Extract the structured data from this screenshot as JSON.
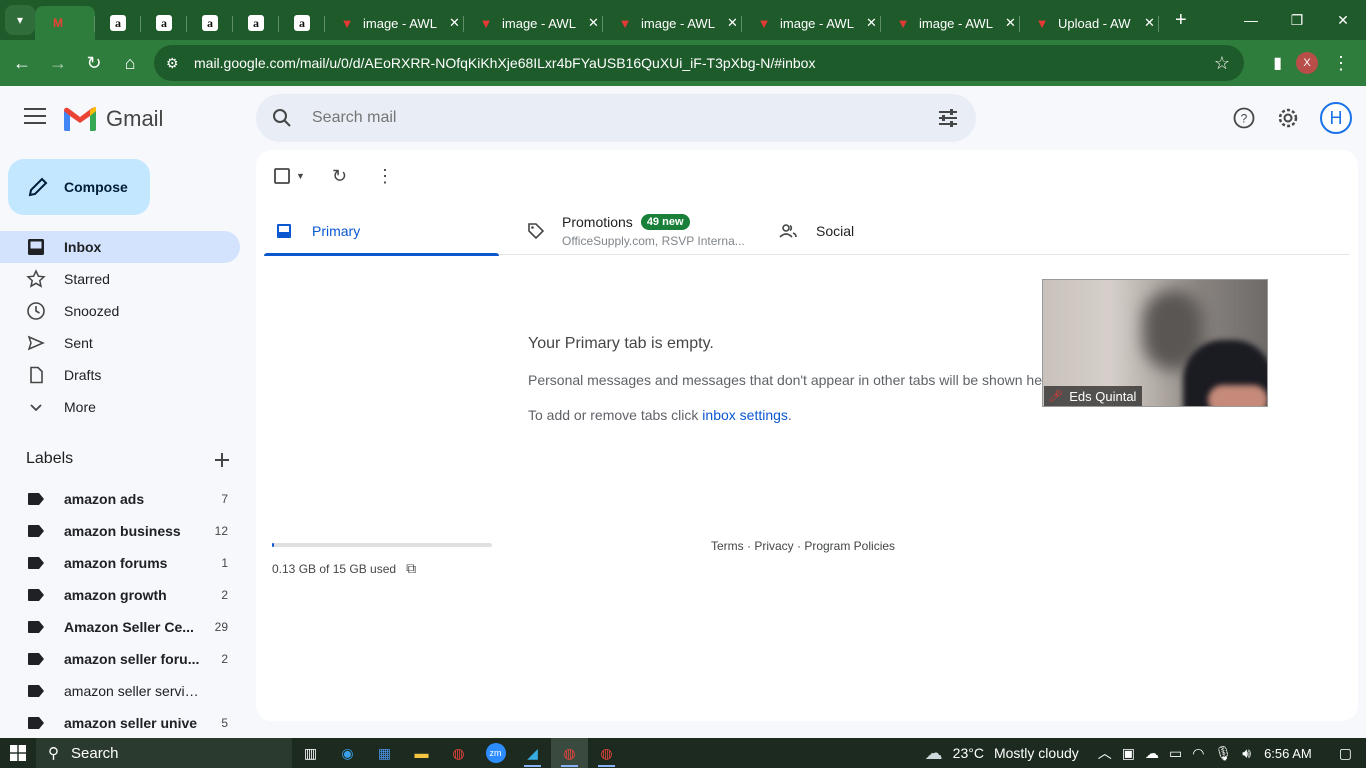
{
  "browser": {
    "tabs": [
      {
        "favicon": "gmail",
        "title": "",
        "active": true
      },
      {
        "favicon": "amazon",
        "title": ""
      },
      {
        "favicon": "amazon",
        "title": ""
      },
      {
        "favicon": "amazon",
        "title": ""
      },
      {
        "favicon": "amazon",
        "title": ""
      },
      {
        "favicon": "amazon",
        "title": ""
      },
      {
        "favicon": "awl",
        "title": "image - AWL"
      },
      {
        "favicon": "awl",
        "title": "image - AWL"
      },
      {
        "favicon": "awl",
        "title": "image - AWL"
      },
      {
        "favicon": "awl",
        "title": "image - AWL"
      },
      {
        "favicon": "awl",
        "title": "image - AWL"
      },
      {
        "favicon": "awl",
        "title": "Upload - AW"
      }
    ],
    "url": "mail.google.com/mail/u/0/d/AEoRXRR-NOfqKiKhXje68ILxr4bFYaUSB16QuXUi_iF-T3pXbg-N/#inbox",
    "profile_initial": "X"
  },
  "gmail": {
    "logo_text": "Gmail",
    "search_placeholder": "Search mail",
    "account_initial": "H",
    "compose_label": "Compose",
    "nav": [
      {
        "icon": "inbox-icon",
        "label": "Inbox",
        "active": true
      },
      {
        "icon": "star-icon",
        "label": "Starred"
      },
      {
        "icon": "clock-icon",
        "label": "Snoozed"
      },
      {
        "icon": "send-icon",
        "label": "Sent"
      },
      {
        "icon": "draft-icon",
        "label": "Drafts"
      },
      {
        "icon": "chevron-down-icon",
        "label": "More"
      }
    ],
    "labels_heading": "Labels",
    "labels": [
      {
        "name": "amazon ads",
        "count": "7",
        "bold": true
      },
      {
        "name": "amazon business",
        "count": "12",
        "bold": true
      },
      {
        "name": "amazon forums",
        "count": "1",
        "bold": true
      },
      {
        "name": "amazon growth",
        "count": "2",
        "bold": true
      },
      {
        "name": "Amazon Seller Ce...",
        "count": "29",
        "bold": true
      },
      {
        "name": "amazon seller foru...",
        "count": "2",
        "bold": true
      },
      {
        "name": "amazon seller services",
        "count": "",
        "bold": false
      },
      {
        "name": "amazon seller unive",
        "count": "5",
        "bold": true
      }
    ],
    "tabs": {
      "primary": "Primary",
      "promotions": "Promotions",
      "promotions_badge": "49 new",
      "promotions_senders": "OfficeSupply.com, RSVP Interna...",
      "social": "Social"
    },
    "empty": {
      "title": "Your Primary tab is empty.",
      "description": "Personal messages and messages that don't appear in other tabs will be shown here.",
      "settings_prefix": "To add or remove tabs click ",
      "settings_link": "inbox settings",
      "settings_suffix": "."
    },
    "storage": {
      "text": "0.13 GB of 15 GB used",
      "fraction": 0.009
    },
    "footer": "Terms · Privacy · Program Policies"
  },
  "video_call": {
    "participant": "Eds Quintal"
  },
  "taskbar": {
    "search_label": "Search",
    "weather_temp": "23°C",
    "weather_desc": "Mostly cloudy",
    "time": "6:56 AM"
  }
}
